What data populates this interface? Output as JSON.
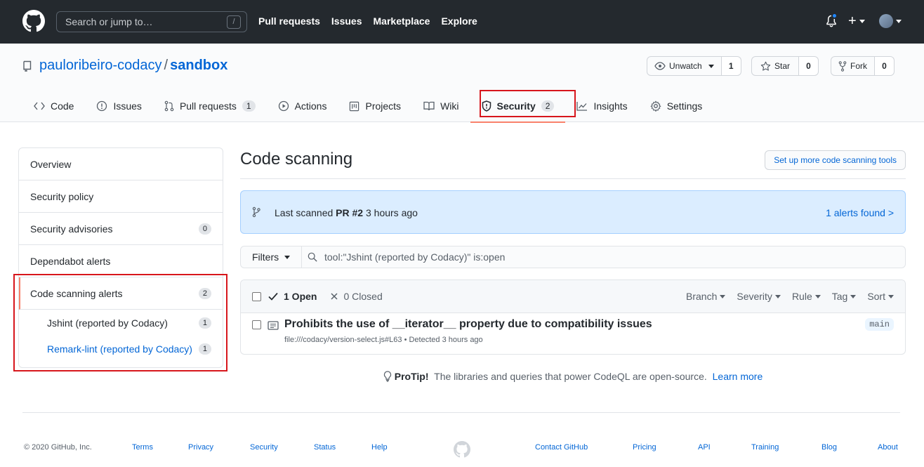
{
  "header": {
    "search_placeholder": "Search or jump to…",
    "slash_key": "/",
    "nav": [
      "Pull requests",
      "Issues",
      "Marketplace",
      "Explore"
    ],
    "plus_label": "+"
  },
  "repo": {
    "owner": "pauloribeiro-codacy",
    "separator": "/",
    "name": "sandbox",
    "watch_label": "Unwatch",
    "watch_count": "1",
    "star_label": "Star",
    "star_count": "0",
    "fork_label": "Fork",
    "fork_count": "0"
  },
  "tabs": [
    {
      "label": "Code",
      "icon": "code-icon"
    },
    {
      "label": "Issues",
      "icon": "issue-icon"
    },
    {
      "label": "Pull requests",
      "icon": "pull-request-icon",
      "count": "1"
    },
    {
      "label": "Actions",
      "icon": "play-icon"
    },
    {
      "label": "Projects",
      "icon": "project-icon"
    },
    {
      "label": "Wiki",
      "icon": "book-icon"
    },
    {
      "label": "Security",
      "icon": "shield-icon",
      "count": "2",
      "selected": true
    },
    {
      "label": "Insights",
      "icon": "graph-icon"
    },
    {
      "label": "Settings",
      "icon": "gear-icon"
    }
  ],
  "sidebar": {
    "items": [
      {
        "label": "Overview"
      },
      {
        "label": "Security policy"
      },
      {
        "label": "Security advisories",
        "count": "0"
      },
      {
        "label": "Dependabot alerts"
      },
      {
        "label": "Code scanning alerts",
        "count": "2",
        "active": true
      }
    ],
    "subitems": [
      {
        "label": "Jshint (reported by Codacy)",
        "count": "1"
      },
      {
        "label": "Remark-lint (reported by Codacy)",
        "count": "1",
        "link": true
      }
    ]
  },
  "main": {
    "title": "Code scanning",
    "setup_button": "Set up more code scanning tools",
    "flash": {
      "prefix": "Last scanned ",
      "pr": "PR #2",
      "suffix": " 3 hours ago",
      "right_link": "1 alerts found >"
    },
    "filters_button": "Filters",
    "filter_query": "tool:\"Jshint (reported by Codacy)\" is:open",
    "open_label": "1 Open",
    "closed_label": "0 Closed",
    "head_filters": [
      "Branch",
      "Severity",
      "Rule",
      "Tag",
      "Sort"
    ],
    "alert": {
      "title": "Prohibits the use of __iterator__ property due to compatibility issues",
      "meta": "file:///codacy/version-select.js#L63 • Detected 3 hours ago",
      "branch": "main"
    },
    "protip": {
      "bold": "ProTip!",
      "text": " The libraries and queries that power CodeQL are open-source. ",
      "link": "Learn more"
    }
  },
  "footer": {
    "copyright": "© 2020 GitHub, Inc.",
    "left_links": [
      "Terms",
      "Privacy",
      "Security",
      "Status",
      "Help"
    ],
    "right_links": [
      "Contact GitHub",
      "Pricing",
      "API",
      "Training",
      "Blog",
      "About"
    ]
  },
  "colors": {
    "header_bg": "#24292e",
    "link": "#0366d6",
    "tab_underline": "#f9826c",
    "highlight_box": "#d7161c",
    "flash_bg": "#dbedff"
  }
}
